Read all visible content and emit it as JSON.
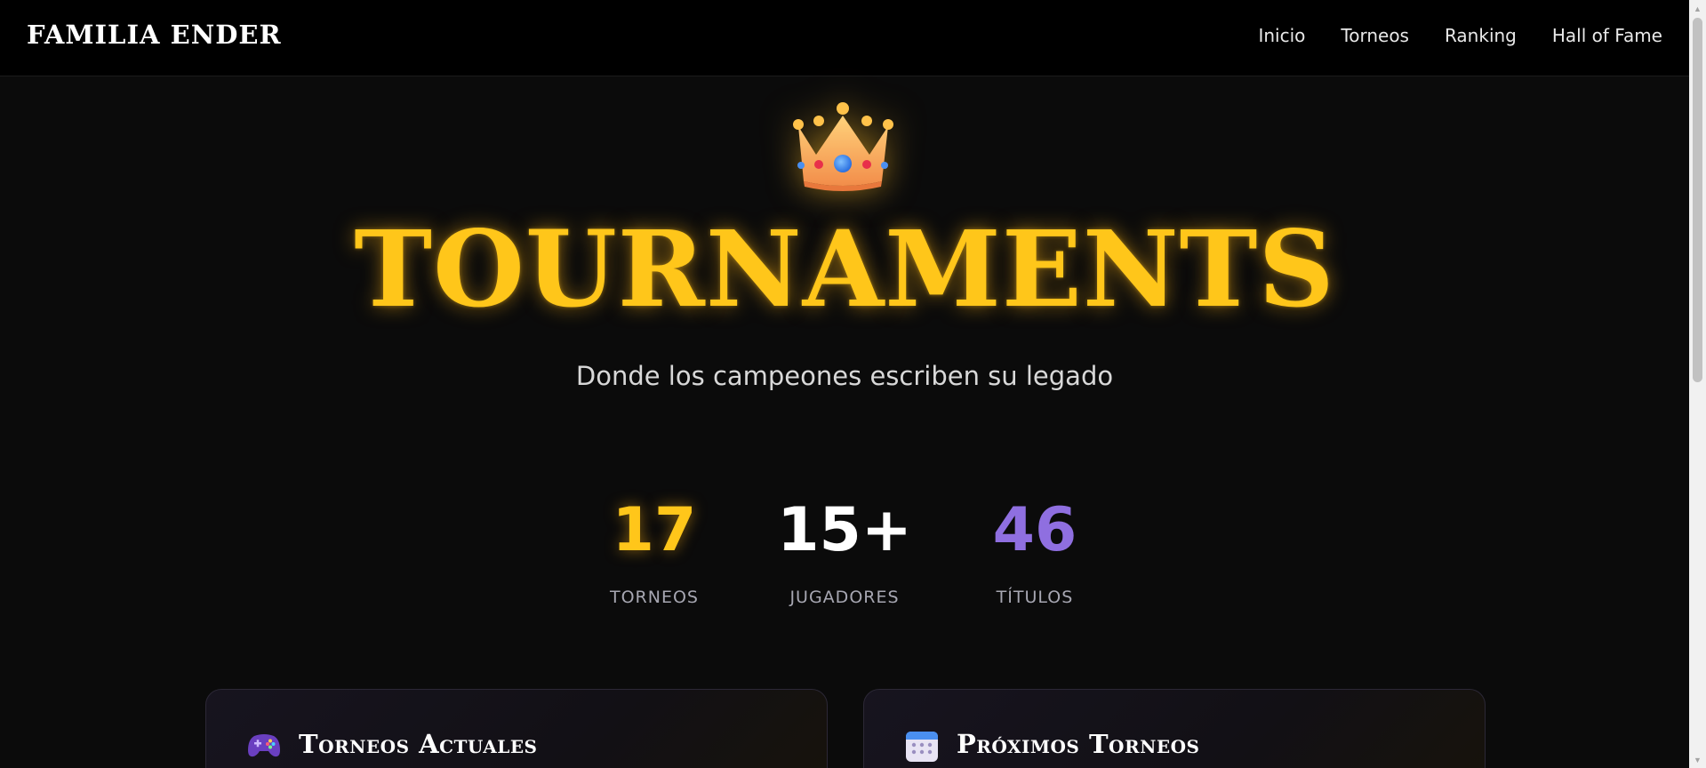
{
  "navbar": {
    "brand": "FAMILIA ENDER",
    "links": [
      "Inicio",
      "Torneos",
      "Ranking",
      "Hall of Fame"
    ]
  },
  "hero": {
    "icon": "crown-icon",
    "title": "TOURNAMENTS",
    "subtitle": "Donde los campeones escriben su legado"
  },
  "stats": [
    {
      "value": "17",
      "label": "TORNEOS",
      "color": "#ffc61a"
    },
    {
      "value": "15+",
      "label": "JUGADORES",
      "color": "#ffffff"
    },
    {
      "value": "46",
      "label": "TÍTULOS",
      "color": "#8f6fe0"
    }
  ],
  "cards": [
    {
      "icon": "gamepad-icon",
      "title": "Torneos Actuales"
    },
    {
      "icon": "calendar-icon",
      "title": "Próximos Torneos"
    }
  ],
  "colors": {
    "accent_gold": "#ffc61a",
    "accent_purple": "#8f6fe0",
    "background": "#0b0b0b"
  }
}
